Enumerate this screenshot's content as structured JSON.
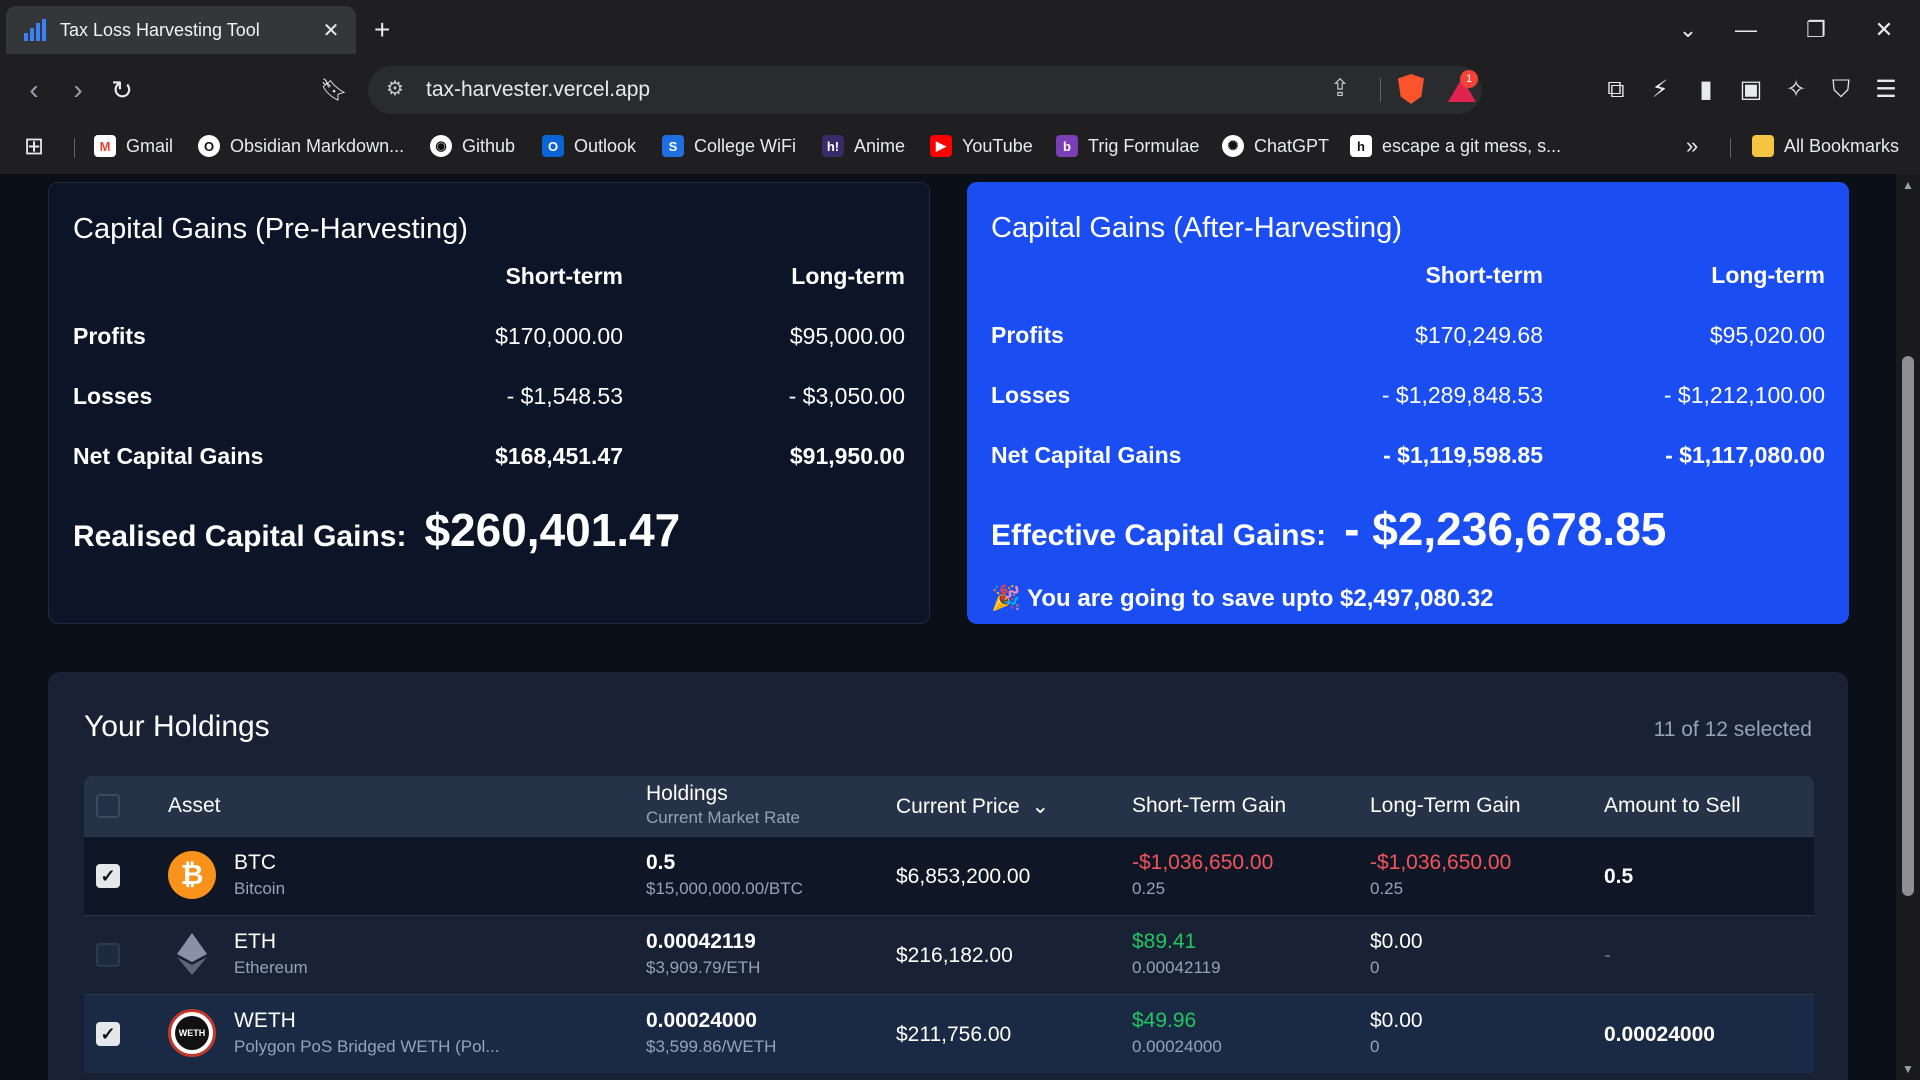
{
  "browser": {
    "tab_title": "Tax Loss Harvesting Tool",
    "url": "tax-harvester.vercel.app",
    "notification_count": "1",
    "bookmarks": [
      "Gmail",
      "Obsidian Markdown...",
      "Github",
      "Outlook",
      "College WiFi",
      "Anime",
      "YouTube",
      "Trig Formulae",
      "ChatGPT",
      "escape a git mess, s..."
    ],
    "all_bookmarks": "All Bookmarks"
  },
  "pre": {
    "title": "Capital Gains (Pre-Harvesting)",
    "short_label": "Short-term",
    "long_label": "Long-term",
    "profits_label": "Profits",
    "losses_label": "Losses",
    "net_label": "Net Capital Gains",
    "profits_short": "$170,000.00",
    "profits_long": "$95,000.00",
    "losses_short": "- $1,548.53",
    "losses_long": "- $3,050.00",
    "net_short": "$168,451.47",
    "net_long": "$91,950.00",
    "realised_label": "Realised Capital Gains:",
    "realised_value": "$260,401.47"
  },
  "post": {
    "title": "Capital Gains (After-Harvesting)",
    "short_label": "Short-term",
    "long_label": "Long-term",
    "profits_label": "Profits",
    "losses_label": "Losses",
    "net_label": "Net Capital Gains",
    "profits_short": "$170,249.68",
    "profits_long": "$95,020.00",
    "losses_short": "- $1,289,848.53",
    "losses_long": "- $1,212,100.00",
    "net_short": "- $1,119,598.85",
    "net_long": "- $1,117,080.00",
    "effective_label": "Effective Capital Gains:",
    "effective_value": "- $2,236,678.85",
    "save_emoji": "🎉",
    "save_text": "You are going to save upto $2,497,080.32"
  },
  "holdings": {
    "title": "Your Holdings",
    "selected": "11 of 12 selected",
    "columns": {
      "asset": "Asset",
      "holdings": "Holdings",
      "holdings_sub": "Current Market Rate",
      "price": "Current Price",
      "short": "Short-Term Gain",
      "long": "Long-Term Gain",
      "sell": "Amount to Sell"
    },
    "rows": [
      {
        "symbol": "BTC",
        "name": "Bitcoin",
        "amount": "0.5",
        "rate": "$15,000,000.00/BTC",
        "price": "$6,853,200.00",
        "short": "-$1,036,650.00",
        "short_sub": "0.25",
        "long": "-$1,036,650.00",
        "long_sub": "0.25",
        "sell": "0.5",
        "checked": true
      },
      {
        "symbol": "ETH",
        "name": "Ethereum",
        "amount": "0.00042119",
        "rate": "$3,909.79/ETH",
        "price": "$216,182.00",
        "short": "$89.41",
        "short_sub": "0.00042119",
        "long": "$0.00",
        "long_sub": "0",
        "sell": "-",
        "checked": false
      },
      {
        "symbol": "WETH",
        "name": "Polygon PoS Bridged WETH (Pol...",
        "amount": "0.00024000",
        "rate": "$3,599.86/WETH",
        "price": "$211,756.00",
        "short": "$49.96",
        "short_sub": "0.00024000",
        "long": "$0.00",
        "long_sub": "0",
        "sell": "0.00024000",
        "checked": true
      }
    ]
  }
}
